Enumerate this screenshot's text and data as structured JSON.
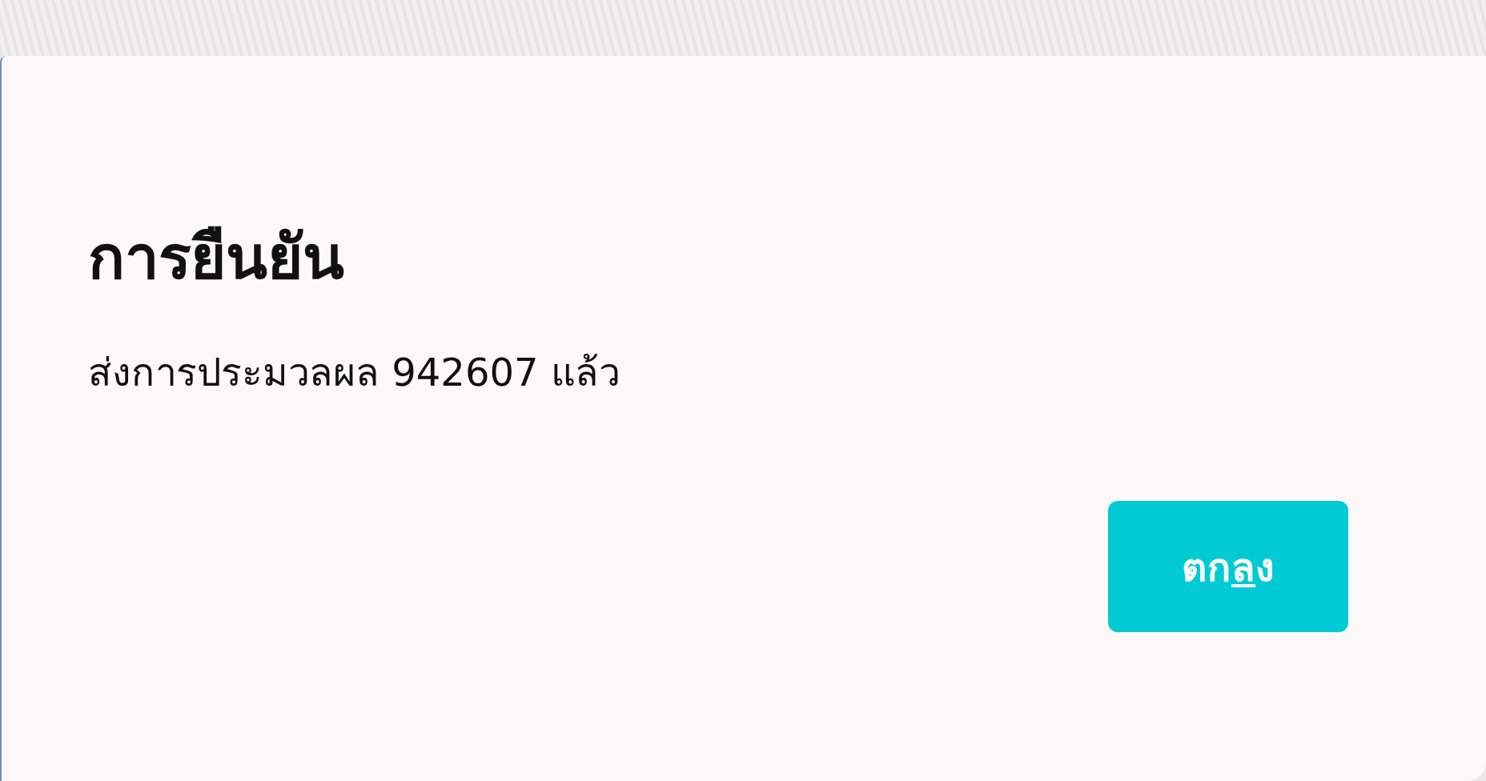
{
  "dialog": {
    "title": "การยืนยัน",
    "message": "ส่งการประมวลผล 942607 แล้ว",
    "buttons": [
      {
        "kind": "primary",
        "label_parts": [
          {
            "text": "ตก",
            "underlined": false
          },
          {
            "text": "ล",
            "underlined": true
          },
          {
            "text": "ง",
            "underlined": false
          }
        ]
      }
    ]
  }
}
